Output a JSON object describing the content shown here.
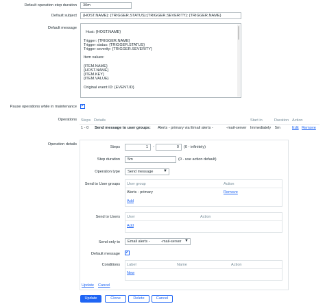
{
  "form": {
    "step_duration_label": "Default operation step duration",
    "step_duration_value": "30m",
    "subject_label": "Default subject",
    "subject_value": "{HOST.NAME}: {TRIGGER.STATUS}:{TRIGGER.SEVERITY}: {TRIGGER.NAME}",
    "message_label": "Default message",
    "message_value": "Host: {HOST.NAME}\n\nTrigger: {TRIGGER.NAME}\nTrigger status: {TRIGGER.STATUS}\nTrigger severity: {TRIGGER.SEVERITY}\n\nItem values:\n\n{ITEM.NAME}\n{HOST.NAME}\n{ITEM.KEY}\n{ITEM.VALUE}\n\nOriginal event ID: {EVENT.ID}",
    "pause_label": "Pause operations while in maintenance",
    "pause_checked": "✔",
    "operations_label": "Operations",
    "op_details_label": "Operation details"
  },
  "operations_table": {
    "headers": {
      "steps": "Steps",
      "details": "Details",
      "start_in": "Start in",
      "duration": "Duration",
      "action": "Action"
    },
    "row": {
      "steps": "1 - 0",
      "details_bold": "Send message to user groups:",
      "details_rest": "Alerts - primary via Email alerts -",
      "details_tail": "-mail-server",
      "start_in": "Immediately",
      "duration": "5m",
      "edit": "Edit",
      "remove": "Remove"
    }
  },
  "details": {
    "steps_label": "Steps",
    "steps_from": "1",
    "steps_dash": "-",
    "steps_to": "0",
    "steps_hint": "(0 - infinitely)",
    "step_duration_label": "Step duration",
    "step_duration_value": "5m",
    "step_duration_hint": "(0 - use action default)",
    "op_type_label": "Operation type",
    "op_type_value": "Send message",
    "send_groups_label": "Send to User groups",
    "groups_header_group": "User group",
    "groups_header_action": "Action",
    "groups_row_name": "Alerts - primary",
    "groups_row_remove": "Remove",
    "groups_add": "Add",
    "send_users_label": "Send to Users",
    "users_header_user": "User",
    "users_header_action": "Action",
    "users_add": "Add",
    "send_only_label": "Send only to",
    "send_only_value": "Email alerts -",
    "send_only_tail": "-mail-server",
    "default_msg_label": "Default message",
    "default_msg_checked": "✔",
    "conditions_label": "Conditions",
    "cond_header_label": "Label",
    "cond_header_name": "Name",
    "cond_header_action": "Action",
    "cond_new": "New",
    "update_link": "Update",
    "cancel_link": "Cancel"
  },
  "buttons": {
    "update": "Update",
    "clone": "Clone",
    "delete": "Delete",
    "cancel": "Cancel"
  },
  "icons": {
    "dropdown": "chevron-down-icon",
    "checkbox": "checkmark-icon"
  }
}
